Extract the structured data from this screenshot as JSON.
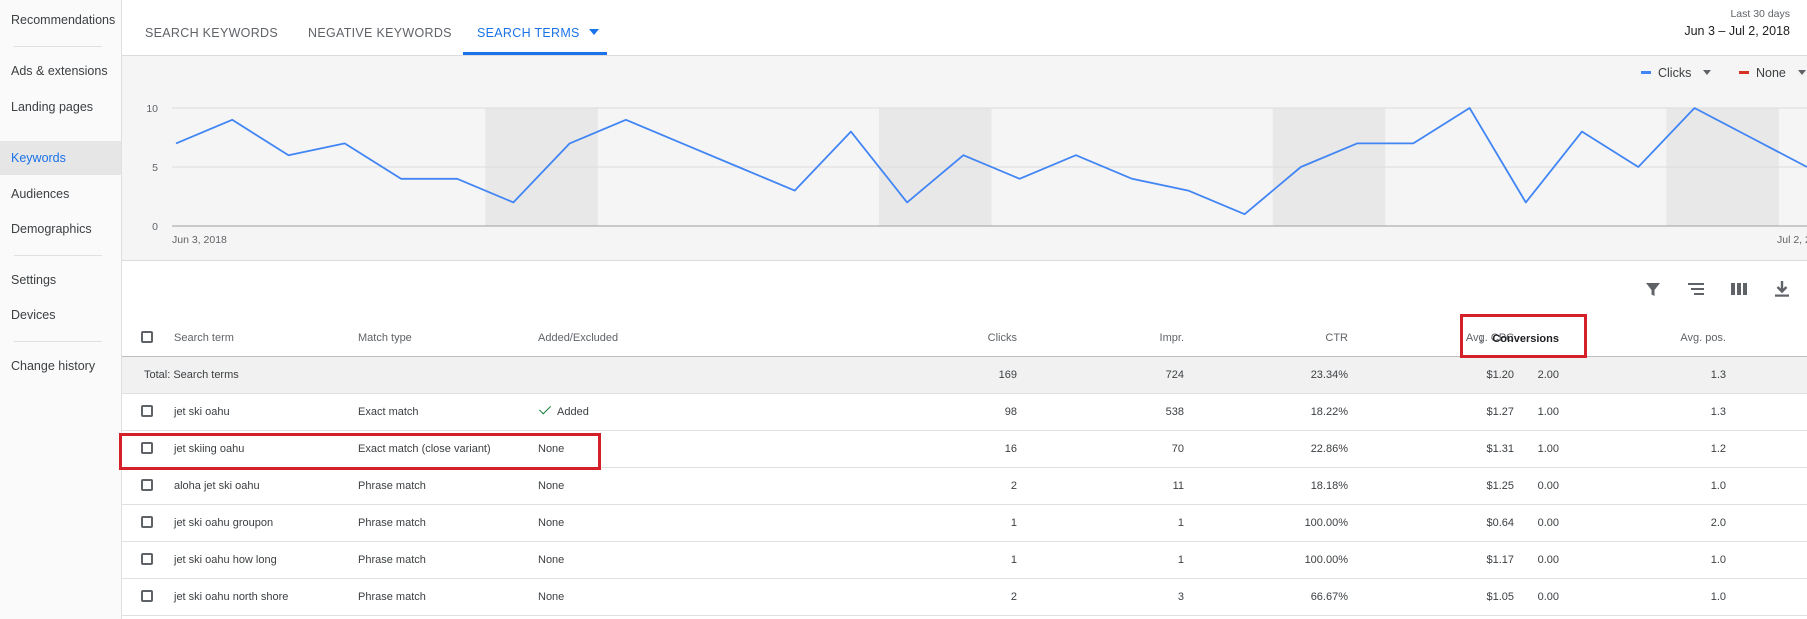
{
  "sidebar": {
    "items": [
      {
        "label": "Recommendations"
      },
      {
        "label": "Ads & extensions"
      },
      {
        "label": "Landing pages"
      },
      {
        "label": "Keywords"
      },
      {
        "label": "Audiences"
      },
      {
        "label": "Demographics"
      },
      {
        "label": "Settings"
      },
      {
        "label": "Devices"
      },
      {
        "label": "Change history"
      }
    ],
    "active": "Keywords"
  },
  "tabs": [
    {
      "label": "SEARCH KEYWORDS"
    },
    {
      "label": "NEGATIVE KEYWORDS"
    },
    {
      "label": "SEARCH TERMS"
    }
  ],
  "date": {
    "label": "Last 30 days",
    "range": "Jun 3 – Jul 2, 2018"
  },
  "metrics": {
    "primary": {
      "label": "Clicks",
      "color": "#4285f4"
    },
    "secondary": {
      "label": "None",
      "color": "#d93025"
    }
  },
  "chart_data": {
    "type": "line",
    "x": [
      "Jun 3",
      "Jun 4",
      "Jun 5",
      "Jun 6",
      "Jun 7",
      "Jun 8",
      "Jun 9",
      "Jun 10",
      "Jun 11",
      "Jun 12",
      "Jun 13",
      "Jun 14",
      "Jun 15",
      "Jun 16",
      "Jun 17",
      "Jun 18",
      "Jun 19",
      "Jun 20",
      "Jun 21",
      "Jun 22",
      "Jun 23",
      "Jun 24",
      "Jun 25",
      "Jun 26",
      "Jun 27",
      "Jun 28",
      "Jun 29",
      "Jun 30",
      "Jul 1",
      "Jul 2"
    ],
    "series": [
      {
        "name": "Clicks",
        "values": [
          7,
          9,
          6,
          7,
          4,
          4,
          2,
          7,
          9,
          7,
          5,
          3,
          8,
          2,
          6,
          4,
          6,
          4,
          3,
          1,
          5,
          7,
          7,
          10,
          2,
          8,
          5,
          10,
          7.5,
          5
        ]
      }
    ],
    "x_tick_labels": [
      "Jun 3, 2018",
      "Jul 2, 2018"
    ],
    "y_ticks": [
      0,
      5,
      10
    ],
    "ylim": [
      0,
      10
    ],
    "grid": true,
    "weekend_shading": true
  },
  "toolbar": {
    "icons": [
      "filter-icon",
      "segment-icon",
      "columns-icon",
      "download-icon"
    ]
  },
  "table": {
    "headers": {
      "search_term": "Search term",
      "match_type": "Match type",
      "added_excluded": "Added/Excluded",
      "clicks": "Clicks",
      "impr": "Impr.",
      "ctr": "CTR",
      "avg_cpc": "Avg. CPC",
      "conversions": "Conversions",
      "avg_pos": "Avg. pos."
    },
    "total": {
      "label": "Total: Search terms",
      "clicks": "169",
      "impr": "724",
      "ctr": "23.34%",
      "avg_cpc": "$1.20",
      "conversions": "2.00",
      "avg_pos": "1.3"
    },
    "rows": [
      {
        "term": "jet ski oahu",
        "match": "Exact match",
        "added": "Added",
        "clicks": "98",
        "impr": "538",
        "ctr": "18.22%",
        "cpc": "$1.27",
        "conv": "1.00",
        "pos": "1.3"
      },
      {
        "term": "jet skiing oahu",
        "match": "Exact match (close variant)",
        "added": "None",
        "clicks": "16",
        "impr": "70",
        "ctr": "22.86%",
        "cpc": "$1.31",
        "conv": "1.00",
        "pos": "1.2"
      },
      {
        "term": "aloha jet ski oahu",
        "match": "Phrase match",
        "added": "None",
        "clicks": "2",
        "impr": "11",
        "ctr": "18.18%",
        "cpc": "$1.25",
        "conv": "0.00",
        "pos": "1.0"
      },
      {
        "term": "jet ski oahu groupon",
        "match": "Phrase match",
        "added": "None",
        "clicks": "1",
        "impr": "1",
        "ctr": "100.00%",
        "cpc": "$0.64",
        "conv": "0.00",
        "pos": "2.0"
      },
      {
        "term": "jet ski oahu how long",
        "match": "Phrase match",
        "added": "None",
        "clicks": "1",
        "impr": "1",
        "ctr": "100.00%",
        "cpc": "$1.17",
        "conv": "0.00",
        "pos": "1.0"
      },
      {
        "term": "jet ski oahu north shore",
        "match": "Phrase match",
        "added": "None",
        "clicks": "2",
        "impr": "3",
        "ctr": "66.67%",
        "cpc": "$1.05",
        "conv": "0.00",
        "pos": "1.0"
      }
    ]
  }
}
